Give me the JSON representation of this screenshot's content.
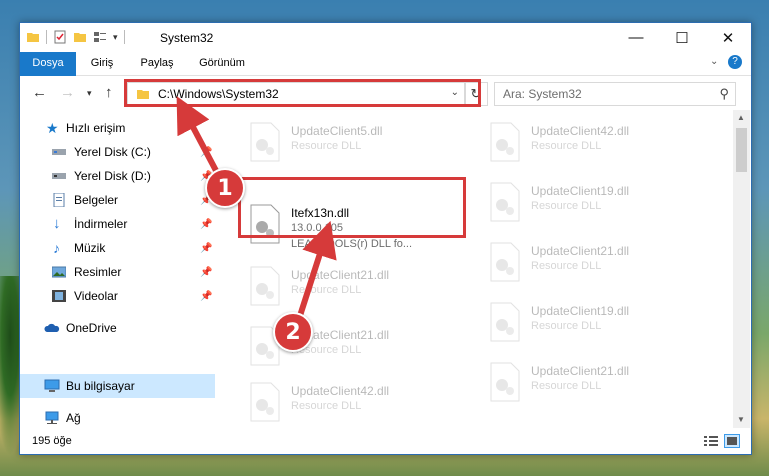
{
  "window": {
    "title": "System32",
    "controls": {
      "minimize": "—",
      "maximize": "☐",
      "close": "✕"
    }
  },
  "ribbon": {
    "tabs": [
      "Dosya",
      "Giriş",
      "Paylaş",
      "Görünüm"
    ],
    "accent": "#1979ca"
  },
  "nav": {
    "address": "C:\\Windows\\System32",
    "search_placeholder": "Ara: System32"
  },
  "sidebar": {
    "items": [
      {
        "label": "Hızlı erişim",
        "icon": "star-icon",
        "pinned": false
      },
      {
        "label": "Yerel Disk (C:)",
        "icon": "drive-icon",
        "pinned": true
      },
      {
        "label": "Yerel Disk (D:)",
        "icon": "drive-icon",
        "pinned": true
      },
      {
        "label": "Belgeler",
        "icon": "documents-icon",
        "pinned": true
      },
      {
        "label": "İndirmeler",
        "icon": "download-icon",
        "pinned": true
      },
      {
        "label": "Müzik",
        "icon": "music-icon",
        "pinned": true
      },
      {
        "label": "Resimler",
        "icon": "pictures-icon",
        "pinned": true
      },
      {
        "label": "Videolar",
        "icon": "videos-icon",
        "pinned": true
      },
      {
        "label": "OneDrive",
        "icon": "cloud-icon",
        "pinned": false
      },
      {
        "label": "Bu bilgisayar",
        "icon": "computer-icon",
        "pinned": false,
        "selected": true
      },
      {
        "label": "Ağ",
        "icon": "network-icon",
        "pinned": false
      }
    ]
  },
  "files": {
    "highlighted": {
      "name": "Itefx13n.dll",
      "version": "13.0.0.105",
      "description": "LEADTOOLS(r) DLL fo..."
    },
    "left_column": [
      {
        "name": "UpdateClient5.dll",
        "desc": "Resource DLL"
      },
      {
        "name": "UpdateClient21.dll",
        "desc": "Resource DLL"
      },
      {
        "name": "UpdateClient21.dll",
        "desc": "Resource DLL"
      },
      {
        "name": "UpdateClient42.dll",
        "desc": "Resource DLL"
      }
    ],
    "right_column": [
      {
        "name": "UpdateClient42.dll",
        "desc": "Resource DLL"
      },
      {
        "name": "UpdateClient19.dll",
        "desc": "Resource DLL"
      },
      {
        "name": "UpdateClient21.dll",
        "desc": "Resource DLL"
      },
      {
        "name": "UpdateClient19.dll",
        "desc": "Resource DLL"
      },
      {
        "name": "UpdateClient21.dll",
        "desc": "Resource DLL"
      }
    ]
  },
  "status": {
    "count": "195 öğe"
  },
  "annotations": {
    "step1": "1",
    "step2": "2",
    "color": "#d63a3a"
  }
}
